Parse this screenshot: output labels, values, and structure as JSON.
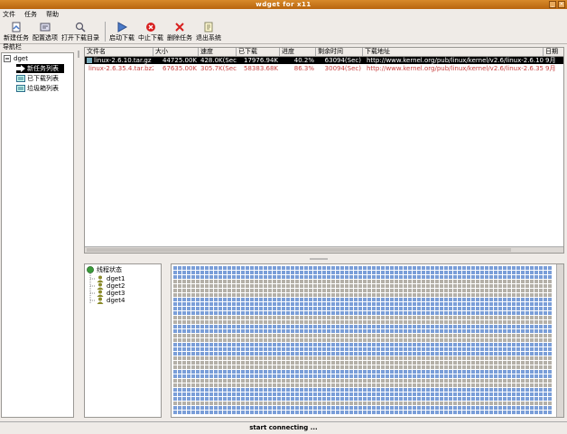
{
  "window": {
    "title": "wdget for x11"
  },
  "menu": [
    "文件",
    "任务",
    "帮助"
  ],
  "toolbar": [
    {
      "label": "新建任务",
      "icon": "new-task-icon"
    },
    {
      "label": "配置选项",
      "icon": "config-icon"
    },
    {
      "label": "打开下载目录",
      "icon": "open-folder-icon"
    },
    {
      "label": "启动下载",
      "icon": "play-icon"
    },
    {
      "label": "中止下载",
      "icon": "stop-icon"
    },
    {
      "label": "删除任务",
      "icon": "delete-icon"
    },
    {
      "label": "退出系统",
      "icon": "exit-icon"
    }
  ],
  "nav": {
    "header": "导航栏",
    "root": "dget",
    "items": [
      "新任务列表",
      "已下载列表",
      "垃圾箱列表"
    ]
  },
  "table": {
    "columns": [
      "文件名",
      "大小",
      "速度",
      "已下载",
      "进度",
      "剩余时间",
      "下载地址",
      "日期"
    ],
    "rows": [
      [
        "linux-2.6.10.tar.gz",
        "44725.00K",
        "428.0K(Sec)",
        "17976.94K",
        "40.2%",
        "63094(Sec)",
        "http://www.kernel.org/pub/linux/kernel/v2.6/linux-2.6.10.tar.gz",
        "9月"
      ],
      [
        "linux-2.6.35.4.tar.bz2",
        "67635.00K",
        "305.7K(Sec)",
        "58383.68K",
        "86.3%",
        "30094(Sec)",
        "http://www.kernel.org/pub/linux/kernel/v2.6/linux-2.6.35.4.tar.bz2",
        "9月"
      ]
    ]
  },
  "threads": {
    "root": "线程状态",
    "items": [
      "dget1",
      "dget2",
      "dget3",
      "dget4"
    ]
  },
  "blockgrid": {
    "colors": {
      "done": "#7a9ed8",
      "pending": "#b4b0a8"
    }
  },
  "status": "start connecting ..."
}
